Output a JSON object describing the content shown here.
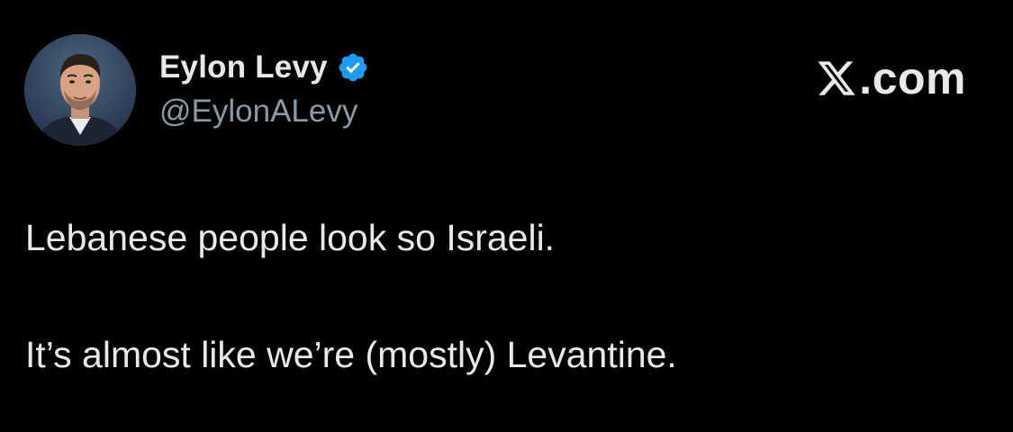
{
  "author": {
    "display_name": "Eylon Levy",
    "handle": "@EylonALevy",
    "verified": true
  },
  "brand": {
    "text": ".com",
    "logo_icon": "x-logo-icon"
  },
  "tweet": {
    "paragraphs": [
      "Lebanese people look so Israeli.",
      "It’s almost like we’re (mostly) Levantine."
    ]
  },
  "colors": {
    "background": "#000000",
    "text_primary": "#e7e9ea",
    "text_secondary": "#8b98a5",
    "verified_badge": "#1d9bf0"
  }
}
